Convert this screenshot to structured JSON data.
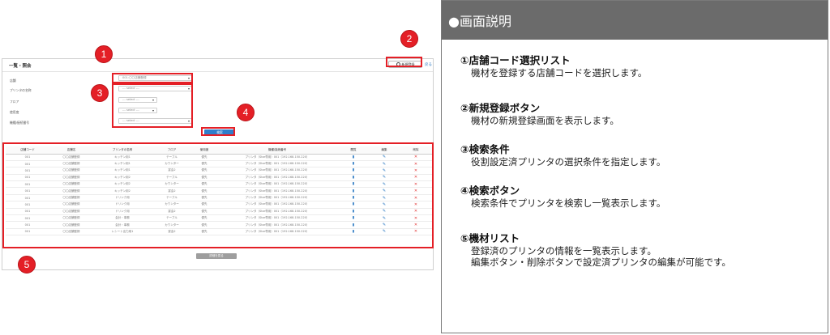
{
  "screen": {
    "title": "一覧・照会",
    "register_button": "新規登録",
    "back_link": "戻る",
    "form": {
      "store_label": "店舗",
      "store_value": "001:〇〇店舗登録",
      "printer_name_label": "プリンタの名称",
      "floor_label": "フロア",
      "use_label": "使用度",
      "model_label": "機種/接続番号",
      "select_placeholder": "--- select ---"
    },
    "search_button": "検索",
    "table": {
      "headers": [
        "店舗コード",
        "店舗名",
        "プリンタの名称",
        "フロア",
        "使用度",
        "機種/接続番号",
        "閲覧",
        "編集",
        "削除"
      ],
      "rows": [
        [
          "001",
          "〇〇店舗登録",
          "キッチン用1",
          "テーブル",
          "優先",
          "プリンタ（Star専用）001（192.168.150.220）"
        ],
        [
          "001",
          "〇〇店舗登録",
          "キッチン用1",
          "カウンター",
          "優先",
          "プリンタ（Star専用）001（192.168.150.220）"
        ],
        [
          "001",
          "〇〇店舗登録",
          "キッチン用1",
          "宴会2",
          "優先",
          "プリンタ（Star専用）001（192.168.150.220）"
        ],
        [
          "001",
          "〇〇店舗登録",
          "キッチン用2",
          "テーブル",
          "優先",
          "プリンタ（Star専用）001（192.168.150.220）"
        ],
        [
          "001",
          "〇〇店舗登録",
          "キッチン用2",
          "カウンター",
          "優先",
          "プリンタ（Star専用）001（192.168.150.220）"
        ],
        [
          "001",
          "〇〇店舗登録",
          "キッチン用2",
          "宴会2",
          "優先",
          "プリンタ（Star専用）001（192.168.150.220）"
        ],
        [
          "001",
          "〇〇店舗登録",
          "ドリンク用",
          "テーブル",
          "優先",
          "プリンタ（Star専用）001（192.168.150.220）"
        ],
        [
          "001",
          "〇〇店舗登録",
          "ドリンク用",
          "カウンター",
          "優先",
          "プリンタ（Star専用）001（192.168.150.220）"
        ],
        [
          "001",
          "〇〇店舗登録",
          "ドリンク用",
          "宴会2",
          "優先",
          "プリンタ（Star専用）001（192.168.150.220）"
        ],
        [
          "001",
          "〇〇店舗登録",
          "会計・事務",
          "テーブル",
          "優先",
          "プリンタ（Star専用）001（192.168.150.220）"
        ],
        [
          "001",
          "〇〇店舗登録",
          "会計・事務",
          "カウンター",
          "優先",
          "プリンタ（Star専用）001（192.168.150.220）"
        ],
        [
          "001",
          "〇〇店舗登録",
          "レシート出力用1",
          "宴会2",
          "優先",
          "プリンタ（Star専用）001（192.168.150.220）"
        ]
      ]
    },
    "more_button": "詳細を見る"
  },
  "callouts": [
    "1",
    "2",
    "3",
    "4",
    "5"
  ],
  "description": {
    "header": "●画面説明",
    "items": [
      {
        "title": "①店舗コード選択リスト",
        "lines": [
          "機材を登録する店舗コードを選択します。"
        ]
      },
      {
        "title": "②新規登録ボタン",
        "lines": [
          "機材の新規登録画面を表示します。"
        ]
      },
      {
        "title": "③検索条件",
        "lines": [
          "役割設定済プリンタの選択条件を指定します。"
        ]
      },
      {
        "title": "④検索ボタン",
        "lines": [
          "検索条件でプリンタを検索し一覧表示します。"
        ]
      },
      {
        "title": "⑤機材リスト",
        "lines": [
          "登録済のプリンタの情報を一覧表示します。",
          "編集ボタン・削除ボタンで設定済プリンタの編集が可能です。"
        ]
      }
    ]
  },
  "colors": {
    "highlight": "#e41f26",
    "primary": "#2f7ecb",
    "header_gray": "#6b6b6b"
  }
}
